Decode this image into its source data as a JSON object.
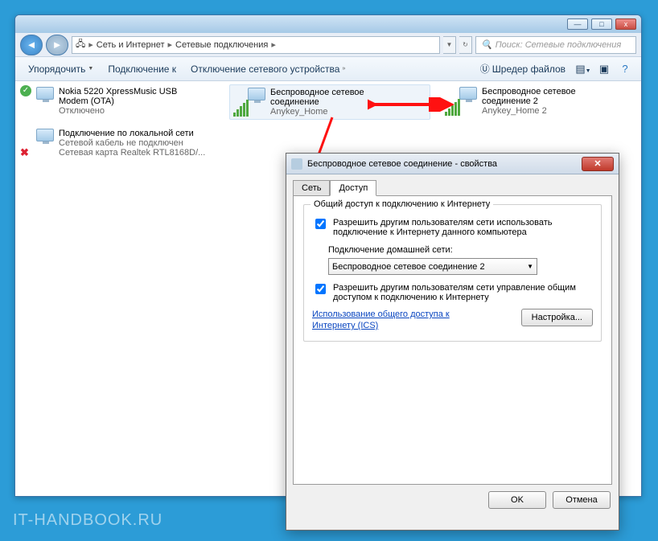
{
  "window_buttons": {
    "min": "—",
    "max": "□",
    "close": "x"
  },
  "breadcrumb": {
    "icon": "⌂",
    "seg1": "Сеть и Интернет",
    "seg2": "Сетевые подключения"
  },
  "search": {
    "placeholder": "Поиск: Сетевые подключения",
    "icon": "🔍"
  },
  "toolbar": {
    "organize": "Упорядочить",
    "connect": "Подключение к",
    "disable": "Отключение сетевого устройства",
    "more": "»",
    "shredder": "Шредер файлов",
    "help": "?"
  },
  "connections": {
    "usb": {
      "line1": "Nokia 5220 XpressMusic USB",
      "line2": "Modem (OTA)",
      "line3": "Отключено"
    },
    "wifi1": {
      "line1": "Беспроводное сетевое",
      "line2": "соединение",
      "line3": "Anykey_Home"
    },
    "wifi2": {
      "line1": "Беспроводное сетевое",
      "line2": "соединение 2",
      "line3": "Anykey_Home 2"
    },
    "lan": {
      "line1": "Подключение по локальной сети",
      "line2": "Сетевой кабель не подключен",
      "line3": "Сетевая карта Realtek RTL8168D/..."
    }
  },
  "dialog": {
    "title": "Беспроводное сетевое соединение - свойства",
    "tabs": {
      "net": "Сеть",
      "share": "Доступ"
    },
    "group_title": "Общий доступ к подключению к Интернету",
    "chk1": "Разрешить другим пользователям сети использовать подключение к Интернету данного компьютера",
    "home_label": "Подключение домашней сети:",
    "home_select": "Беспроводное сетевое соединение 2",
    "chk2": "Разрешить другим пользователям сети управление общим доступом к подключению к Интернету",
    "link": "Использование общего доступа к Интернету (ICS)",
    "settings_btn": "Настройка...",
    "ok": "OK",
    "cancel": "Отмена"
  },
  "watermark": "IT-HANDBOOK.RU"
}
